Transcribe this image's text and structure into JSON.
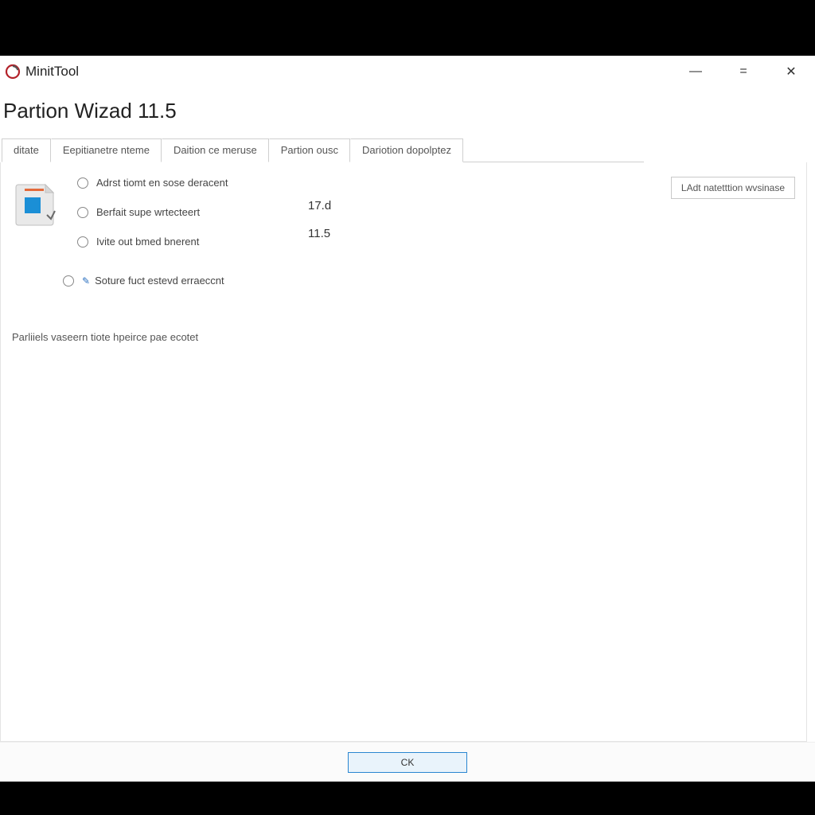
{
  "app": {
    "name": "MinitTool"
  },
  "heading": "Partion Wizad 11.5",
  "tabs": [
    {
      "label": "ditate"
    },
    {
      "label": "Eepitianetre nteme"
    },
    {
      "label": "Daition ce meruse"
    },
    {
      "label": "Partion ousc"
    },
    {
      "label": "Dariotion dopolptez"
    }
  ],
  "options": [
    {
      "label": "Adrst tiomt en sose deracent"
    },
    {
      "label": "Berfait supe wrtecteert"
    },
    {
      "label": "Ivite out bmed bnerent"
    }
  ],
  "alt_option": {
    "label": "Soture fuct estevd erraeccnt"
  },
  "values": {
    "v1": "17.d",
    "v2": "11.5"
  },
  "side_button": "LAdt natetttion wvsinase",
  "hint": "Parliiels vaseern tiote hpeirce pae ecotet",
  "footer": {
    "ok": "CK"
  },
  "win": {
    "min": "—",
    "max": "=",
    "close": "✕"
  }
}
